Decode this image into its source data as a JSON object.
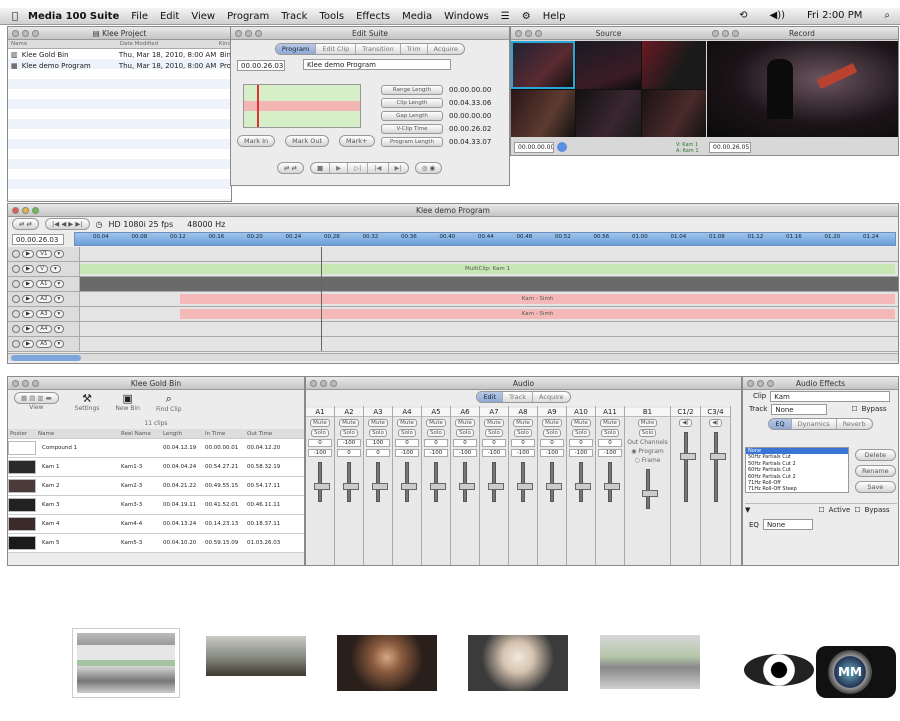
{
  "menubar": {
    "apple": "",
    "app_name": "Media 100 Suite",
    "items": [
      "File",
      "Edit",
      "View",
      "Program",
      "Track",
      "Tools",
      "Effects",
      "Media",
      "Windows"
    ],
    "help": "Help",
    "clock": "Fri 2:00 PM"
  },
  "project": {
    "title": "Klee Project",
    "columns": [
      "Name",
      "Date Modified",
      "Kind"
    ],
    "rows": [
      {
        "name": "Klee Gold Bin",
        "date": "Thu, Mar 18, 2010, 8:00 AM",
        "kind": "Bin"
      },
      {
        "name": "Klee demo Program",
        "date": "Thu, Mar 18, 2010, 8:00 AM",
        "kind": "Pro"
      }
    ]
  },
  "edit_suite": {
    "title": "Edit Suite",
    "tabs": [
      "Program",
      "Edit Clip",
      "Transition",
      "Trim",
      "Acquire"
    ],
    "timecode": "00.00.26.03",
    "program_name": "Klee demo Program",
    "fields": [
      {
        "label": "Range Length",
        "value": "00.00.00.00"
      },
      {
        "label": "Clip Length",
        "value": "00.04.33.06"
      },
      {
        "label": "Gap Length",
        "value": "00.00.00.00"
      },
      {
        "label": "V-Clip Time",
        "value": "00.00.26.02"
      },
      {
        "label": "Program Length",
        "value": "00.04.33.07"
      }
    ],
    "buttons": [
      "Mark In",
      "Mark Out",
      "Mark+"
    ]
  },
  "source": {
    "title": "Source",
    "timecode": "00.00.00.00"
  },
  "record": {
    "title": "Record",
    "v_label": "V: Kam 1",
    "a_label": "A: Kam 1",
    "timecode": "00.00.26.05"
  },
  "timeline": {
    "title": "Klee demo Program",
    "format": "HD 1080i 25 fps",
    "audio_rate": "48000 Hz",
    "timecode": "00.00.26.03",
    "ruler": [
      "00.04",
      "00.08",
      "00.12",
      "00.16",
      "00.20",
      "00.24",
      "00.28",
      "00.32",
      "00.36",
      "00.40",
      "00.44",
      "00.48",
      "00.52",
      "00.56",
      "01.00",
      "01.04",
      "01.08",
      "01.12",
      "01.16",
      "01.20",
      "01.24"
    ],
    "tracks": [
      {
        "label": "V1",
        "clip": ""
      },
      {
        "label": "V",
        "clip": "MultiClip: Kam 1"
      },
      {
        "label": "A1",
        "clip": ""
      },
      {
        "label": "A2",
        "clip": "Kam - Simh"
      },
      {
        "label": "A3",
        "clip": "Kam - Simh"
      },
      {
        "label": "A4",
        "clip": ""
      },
      {
        "label": "A5",
        "clip": ""
      }
    ]
  },
  "bin": {
    "title": "Klee Gold Bin",
    "toolbar": [
      "View",
      "Settings",
      "New Bin",
      "Find Clip"
    ],
    "count": "11 clips",
    "columns": [
      "Poster",
      "Name",
      "Reel Name",
      "Length",
      "In Time",
      "Out Time"
    ],
    "rows": [
      {
        "name": "Compound 1",
        "reel": "",
        "length": "00.04.12.19",
        "in": "00.00.00.01",
        "out": "00.04.12.20"
      },
      {
        "name": "Kam 1",
        "reel": "Kam1-3",
        "length": "00.04.04.24",
        "in": "00.54.27.21",
        "out": "00.58.32.19"
      },
      {
        "name": "Kam 2",
        "reel": "Kam2-3",
        "length": "00.04.21.22",
        "in": "00.49.55.15",
        "out": "00.54.17.11"
      },
      {
        "name": "Kam 3",
        "reel": "Kam3-3",
        "length": "00.04.19.11",
        "in": "00.41.52.01",
        "out": "00.46.11.11"
      },
      {
        "name": "Kam 4",
        "reel": "Kam4-4",
        "length": "00.04.13.24",
        "in": "00.14.23.13",
        "out": "00.18.37.11"
      },
      {
        "name": "Kam 5",
        "reel": "Kam5-3",
        "length": "00.04.10.20",
        "in": "00.59.15.09",
        "out": "01.03.26.03"
      }
    ]
  },
  "audio": {
    "title": "Audio",
    "tabs": [
      "Edit",
      "Track",
      "Acquire"
    ],
    "channels": [
      "A1",
      "A2",
      "A3",
      "A4",
      "A5",
      "A6",
      "A7",
      "A8",
      "A9",
      "A10",
      "A11"
    ],
    "mute": "Mute",
    "solo": "Solo",
    "pans": [
      "0",
      "-100",
      "100",
      "0",
      "0",
      "0",
      "0",
      "0",
      "0",
      "0",
      "0"
    ],
    "levels": [
      "-100",
      "0",
      "0",
      "-100",
      "-100",
      "-100",
      "-100",
      "-100",
      "-100",
      "-100",
      "-100"
    ],
    "bus": "B1",
    "out_channels": "Out Channels",
    "program": "Program",
    "frame": "Frame",
    "outs": [
      "C1/2",
      "C3/4"
    ]
  },
  "effects": {
    "title": "Audio Effects",
    "clip_label": "Clip",
    "clip_value": "Kam",
    "track_label": "Track",
    "track_value": "None",
    "bypass": "Bypass",
    "tabs": [
      "EQ",
      "Dynamics",
      "Reverb"
    ],
    "list": [
      "None",
      "50Hz Partials Cut",
      "50Hz Partials Cut 2",
      "60Hz Partials Cut",
      "60Hz Partials Cut 2",
      "71Hz Roll-Off",
      "71Hz Roll-Off Steep"
    ],
    "buttons": [
      "Delete",
      "Rename",
      "Save"
    ],
    "active": "Active",
    "eq_label": "EQ",
    "eq_value": "None"
  }
}
